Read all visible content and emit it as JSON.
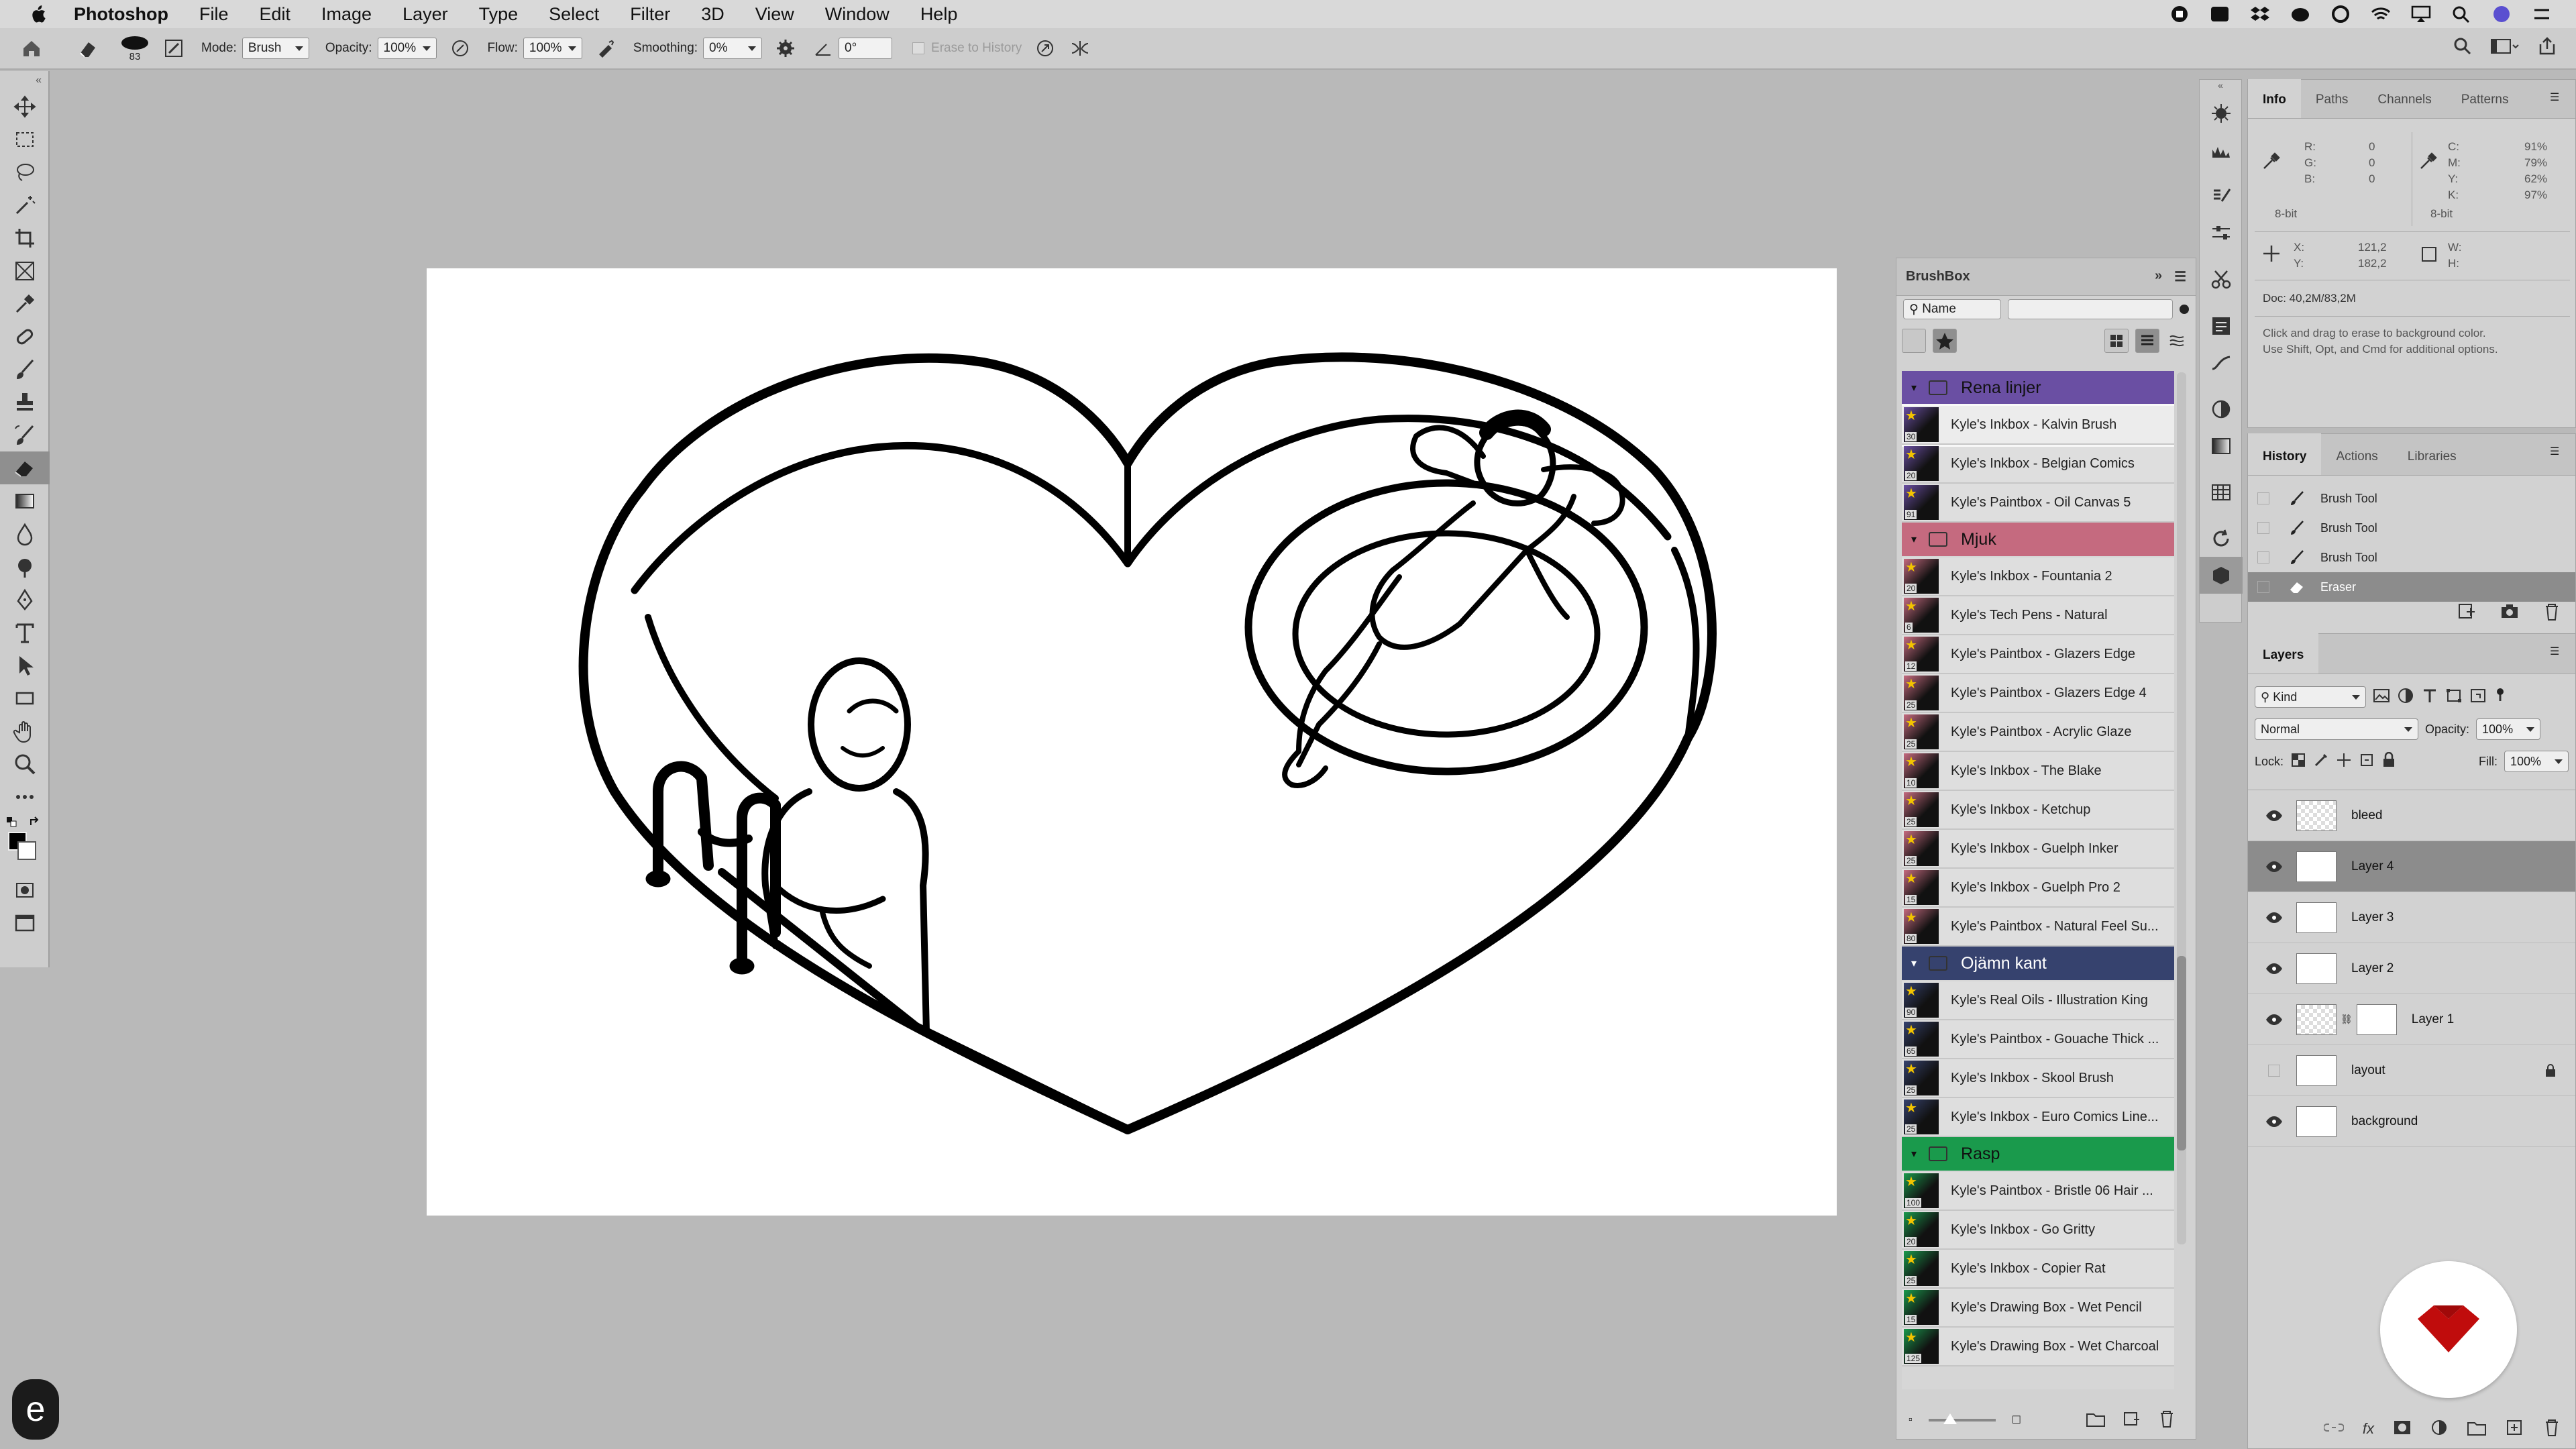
{
  "menubar": {
    "app_name": "Photoshop",
    "items": [
      "File",
      "Edit",
      "Image",
      "Layer",
      "Type",
      "Select",
      "Filter",
      "3D",
      "View",
      "Window",
      "Help"
    ]
  },
  "options_bar": {
    "brush_size": "83",
    "mode_label": "Mode:",
    "mode_value": "Brush",
    "opacity_label": "Opacity:",
    "opacity_value": "100%",
    "flow_label": "Flow:",
    "flow_value": "100%",
    "smoothing_label": "Smoothing:",
    "smoothing_value": "0%",
    "angle_value": "0°",
    "erase_to_history": "Erase to History"
  },
  "tools": [
    "move-tool",
    "marquee-tool",
    "lasso-tool",
    "magic-wand-tool",
    "crop-tool",
    "frame-tool",
    "eyedropper-tool",
    "healing-tool",
    "brush-tool",
    "stamp-tool",
    "history-brush-tool",
    "eraser-tool",
    "gradient-tool",
    "blur-tool",
    "dodge-tool",
    "pen-tool",
    "type-tool",
    "path-select-tool",
    "shape-tool",
    "hand-tool",
    "zoom-tool",
    "more-tools"
  ],
  "active_tool": "eraser-tool",
  "brushbox": {
    "title": "BrushBox",
    "name_select": "Name",
    "groups": [
      {
        "name": "Rena linjer",
        "color": "#6a4fa3",
        "brushes": [
          {
            "name": "Kyle's Inkbox - Kalvin Brush",
            "size": "30",
            "selected": true
          },
          {
            "name": "Kyle's Inkbox - Belgian Comics",
            "size": "20"
          },
          {
            "name": "Kyle's Paintbox - Oil Canvas 5",
            "size": "91"
          }
        ]
      },
      {
        "name": "Mjuk",
        "color": "#c56a7f",
        "brushes": [
          {
            "name": "Kyle's Inkbox - Fountania 2",
            "size": "20"
          },
          {
            "name": "Kyle's Tech Pens - Natural",
            "size": "6"
          },
          {
            "name": "Kyle's Paintbox - Glazers Edge",
            "size": "12"
          },
          {
            "name": "Kyle's Paintbox - Glazers Edge 4",
            "size": "25"
          },
          {
            "name": "Kyle's Paintbox - Acrylic Glaze",
            "size": "25"
          },
          {
            "name": "Kyle's Inkbox - The Blake",
            "size": "10"
          },
          {
            "name": "Kyle's Inkbox - Ketchup",
            "size": "25"
          },
          {
            "name": "Kyle's Inkbox - Guelph Inker",
            "size": "25"
          },
          {
            "name": "Kyle's Inkbox - Guelph Pro 2",
            "size": "15"
          },
          {
            "name": "Kyle's Paintbox - Natural Feel Su...",
            "size": "80"
          }
        ]
      },
      {
        "name": "Ojämn kant",
        "color": "#36426e",
        "brushes": [
          {
            "name": "Kyle's Real Oils - Illustration King",
            "size": "90"
          },
          {
            "name": "Kyle's Paintbox - Gouache Thick ...",
            "size": "65"
          },
          {
            "name": "Kyle's Inkbox - Skool Brush",
            "size": "25"
          },
          {
            "name": "Kyle's Inkbox - Euro Comics Line...",
            "size": "25"
          }
        ]
      },
      {
        "name": "Rasp",
        "color": "#1a9a4c",
        "brushes": [
          {
            "name": "Kyle's Paintbox - Bristle 06 Hair ...",
            "size": "100"
          },
          {
            "name": "Kyle's Inkbox - Go Gritty",
            "size": "20"
          },
          {
            "name": "Kyle's Inkbox - Copier Rat",
            "size": "25"
          },
          {
            "name": "Kyle's Drawing Box - Wet Pencil",
            "size": "15"
          },
          {
            "name": "Kyle's Drawing Box - Wet Charcoal",
            "size": "125"
          }
        ]
      }
    ]
  },
  "info_panel": {
    "tabs": [
      "Info",
      "Paths",
      "Channels",
      "Patterns"
    ],
    "r_label": "R:",
    "r": "0",
    "g_label": "G:",
    "g": "0",
    "b_label": "B:",
    "b": "0",
    "c_label": "C:",
    "c": "91%",
    "m_label": "M:",
    "m": "79%",
    "y_label": "Y:",
    "y": "62%",
    "k_label": "K:",
    "k": "97%",
    "bit_left": "8-bit",
    "bit_right": "8-bit",
    "x_label": "X:",
    "x": "121,2",
    "y2_label": "Y:",
    "y2": "182,2",
    "w_label": "W:",
    "h_label": "H:",
    "doc": "Doc: 40,2M/83,2M",
    "hint_line1": "Click and drag to erase to background color.",
    "hint_line2": "Use Shift, Opt, and Cmd for additional options."
  },
  "history_panel": {
    "tabs": [
      "History",
      "Actions",
      "Libraries"
    ],
    "items": [
      {
        "name": "Brush Tool",
        "icon": "brush-icon"
      },
      {
        "name": "Brush Tool",
        "icon": "brush-icon"
      },
      {
        "name": "Brush Tool",
        "icon": "brush-icon"
      },
      {
        "name": "Eraser",
        "icon": "eraser-icon",
        "selected": true
      }
    ]
  },
  "layers_panel": {
    "title": "Layers",
    "filter_kind": "Kind",
    "blend_mode": "Normal",
    "opacity_label": "Opacity:",
    "opacity": "100%",
    "lock_label": "Lock:",
    "fill_label": "Fill:",
    "fill": "100%",
    "layers": [
      {
        "name": "bleed",
        "visible": true
      },
      {
        "name": "Layer 4",
        "visible": true,
        "selected": true
      },
      {
        "name": "Layer 3",
        "visible": true
      },
      {
        "name": "Layer 2",
        "visible": true
      },
      {
        "name": "Layer 1",
        "visible": true,
        "mask": true
      },
      {
        "name": "layout",
        "visible": false,
        "locked": true
      },
      {
        "name": "background",
        "visible": true
      }
    ]
  },
  "badge_letter": "e"
}
